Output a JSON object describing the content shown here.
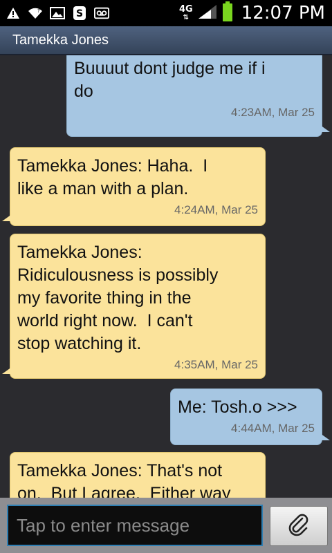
{
  "status_bar": {
    "network_type": "4G",
    "time": "12:07 PM",
    "icons": [
      "warning-icon",
      "wifi-icon",
      "picture-icon",
      "evernote-icon",
      "voicemail-icon",
      "signal-icon",
      "battery-icon"
    ]
  },
  "header": {
    "title": "Tamekka Jones"
  },
  "messages": [
    {
      "direction": "out",
      "text": "Buuuut dont judge me if i\ndo",
      "time": "4:23AM, Mar 25"
    },
    {
      "direction": "in",
      "text": "Tamekka Jones: Haha.  I\nlike a man with a plan.",
      "time": "4:24AM, Mar 25"
    },
    {
      "direction": "in",
      "text": "Tamekka Jones:\nRidiculousness is possibly\nmy favorite thing in the\nworld right now.  I can't\nstop watching it.",
      "time": "4:35AM, Mar 25"
    },
    {
      "direction": "out",
      "text": "Me: Tosh.o >>>",
      "time": "4:44AM, Mar 25"
    },
    {
      "direction": "in",
      "text": "Tamekka Jones: That's not\non.  But I agree.  Either way",
      "time": ""
    }
  ],
  "compose": {
    "placeholder": "Tap to enter message",
    "value": ""
  },
  "colors": {
    "outgoing": "#a6c6e2",
    "incoming": "#fbe39b",
    "battery": "#7ad61f",
    "input_border": "#2f7fb3"
  }
}
